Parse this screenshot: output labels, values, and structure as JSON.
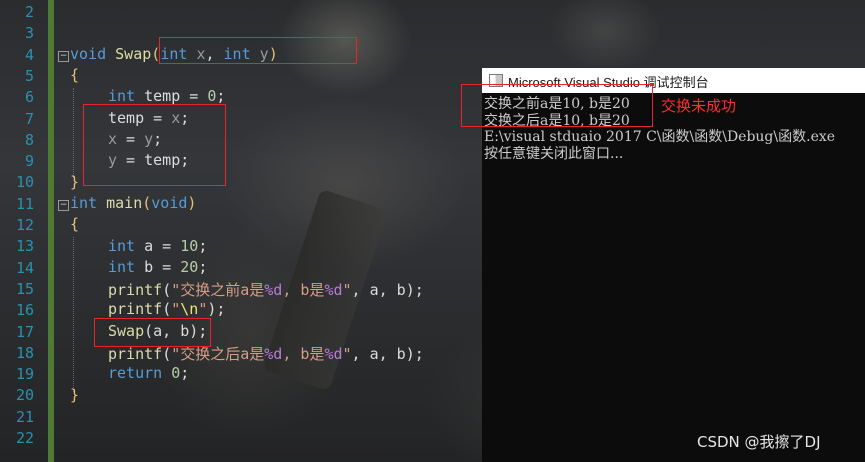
{
  "editor": {
    "line_numbers": [
      "2",
      "3",
      "4",
      "5",
      "6",
      "7",
      "8",
      "9",
      "10",
      "11",
      "12",
      "13",
      "14",
      "15",
      "16",
      "17",
      "18",
      "19",
      "20",
      "21",
      "22"
    ],
    "code": {
      "l4_kw": "void",
      "l4_fn": "Swap",
      "l4_p1_kw": "int",
      "l4_p1": "x",
      "l4_p2_kw": "int",
      "l4_p2": "y",
      "open_brace": "{",
      "close_brace": "}",
      "l6_kw": "int",
      "l6_rest": "temp = ",
      "l6_num": "0",
      "l6_end": ";",
      "l7_a": "temp = ",
      "l7_b": "x",
      "l7_c": ";",
      "l8_a": "x",
      "l8_b": " = ",
      "l8_c": "y",
      "l8_d": ";",
      "l9_a": "y",
      "l9_b": " = temp;",
      "l11_kw": "int",
      "l11_fn": "main",
      "l11_void": "void",
      "l13_kw": "int",
      "l13_rest": "a = ",
      "l13_num": "10",
      "l13_end": ";",
      "l14_kw": "int",
      "l14_rest": "b = ",
      "l14_num": "20",
      "l14_end": ";",
      "l15_fn": "printf",
      "l15_s1": "\"交换之前a是",
      "l15_f1": "%d",
      "l15_s2": ", b是",
      "l15_f2": "%d",
      "l15_s3": "\"",
      "l15_rest": ", a, b);",
      "l16_fn": "printf",
      "l16_s1": "\"",
      "l16_esc": "\\n",
      "l16_s2": "\"",
      "l16_rest": ");",
      "l17_fn": "Swap",
      "l17_rest": "(a, b);",
      "l18_fn": "printf",
      "l18_s1": "\"交换之后a是",
      "l18_f1": "%d",
      "l18_s2": ", b是",
      "l18_f2": "%d",
      "l18_s3": "\"",
      "l18_rest": ", a, b);",
      "l19_kw": "return",
      "l19_num": "0",
      "l19_end": ";"
    }
  },
  "console": {
    "title": "Microsoft Visual Studio 调试控制台",
    "lines": [
      "交换之前a是10, b是20",
      "交换之后a是10, b是20",
      "E:\\visual stduaio 2017 C\\函数\\函数\\Debug\\函数.exe",
      "按任意键关闭此窗口..."
    ]
  },
  "annotation": "交换未成功",
  "watermark": "CSDN @我擦了DJ",
  "colors": {
    "keyword": "#569cd6",
    "function": "#dcdcaa",
    "string": "#d69d85",
    "number": "#b5cea8",
    "line_number": "#2b91af",
    "highlight_box": "#e5262b",
    "annotation": "#ff2d2d"
  }
}
